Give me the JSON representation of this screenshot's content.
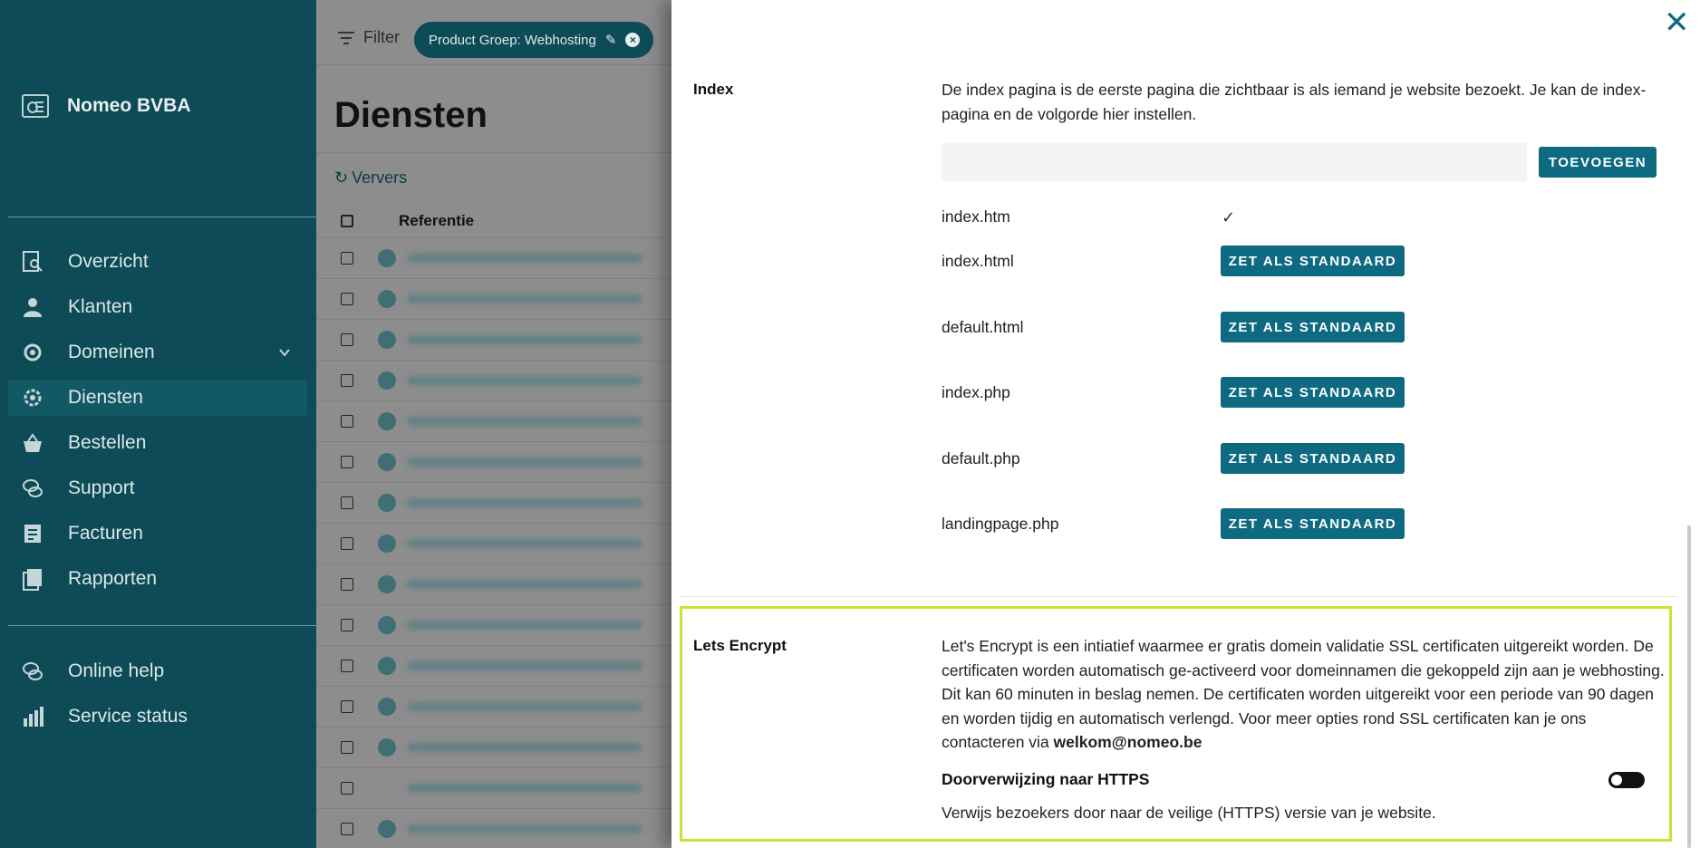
{
  "sidebar": {
    "company": "Nomeo BVBA",
    "nav": [
      {
        "label": "Overzicht",
        "icon": "overview-icon"
      },
      {
        "label": "Klanten",
        "icon": "customers-icon"
      },
      {
        "label": "Domeinen",
        "icon": "domains-icon"
      },
      {
        "label": "Diensten",
        "icon": "services-icon"
      },
      {
        "label": "Bestellen",
        "icon": "basket-icon"
      },
      {
        "label": "Support",
        "icon": "support-icon"
      },
      {
        "label": "Facturen",
        "icon": "invoice-icon"
      },
      {
        "label": "Rapporten",
        "icon": "reports-icon"
      }
    ],
    "secondary": [
      {
        "label": "Online help",
        "icon": "help-icon"
      },
      {
        "label": "Service status",
        "icon": "status-icon"
      }
    ],
    "active": "Diensten"
  },
  "list": {
    "filter_label": "Filter",
    "chip_label": "Product Groep: Webhosting",
    "title": "Diensten",
    "refresh_label": "Ververs",
    "column_reference": "Referentie"
  },
  "drawer": {
    "index": {
      "label": "Index",
      "description": "De index pagina is de eerste pagina die zichtbaar is als iemand je website bezoekt. Je kan de index-pagina en de volgorde hier instellen.",
      "input_value": "",
      "add_button": "TOEVOEGEN",
      "default_file": "index.htm",
      "files": [
        "index.html",
        "default.html",
        "index.php",
        "default.php",
        "landingpage.php"
      ],
      "set_default_button": "ZET ALS STANDAARD"
    },
    "letsencrypt": {
      "label": "Lets Encrypt",
      "description": "Let's Encrypt is een intiatief waarmee er gratis domein validatie SSL certificaten uitgereikt worden. De certificaten worden automatisch ge-activeerd voor domeinnamen die gekoppeld zijn aan je webhosting. Dit kan 60 minuten in beslag nemen. De certificaten worden uitgereikt voor een periode van 90 dagen en worden tijdig en automatisch verlengd. Voor meer opties rond SSL certificaten kan je ons contacteren via ",
      "email": "welkom@nomeo.be",
      "https_label": "Doorverwijzing naar HTTPS",
      "https_help": "Verwijs bezoekers door naar de veilige (HTTPS) versie van je website.",
      "https_enabled": false
    }
  },
  "colors": {
    "sidebar": "#0d4b57",
    "primary_button": "#0d6a80",
    "highlight": "#c8e436"
  }
}
